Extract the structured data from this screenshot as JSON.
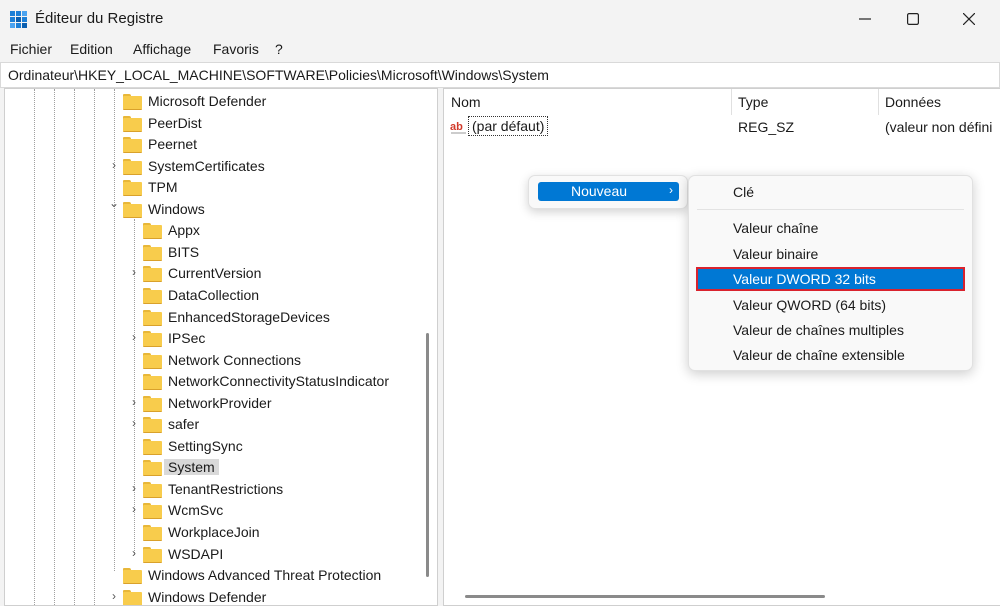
{
  "window": {
    "title": "Éditeur du Registre",
    "icon": "registry-icon",
    "controls": {
      "minimize": "minimize-icon",
      "maximize": "maximize-icon",
      "close": "close-icon"
    }
  },
  "menubar": {
    "items": [
      "Fichier",
      "Edition",
      "Affichage",
      "Favoris",
      "?"
    ]
  },
  "address": {
    "path": "Ordinateur\\HKEY_LOCAL_MACHINE\\SOFTWARE\\Policies\\Microsoft\\Windows\\System"
  },
  "tree": {
    "items": [
      {
        "label": "Microsoft Defender",
        "level": 0,
        "expander": ""
      },
      {
        "label": "PeerDist",
        "level": 0,
        "expander": ""
      },
      {
        "label": "Peernet",
        "level": 0,
        "expander": ""
      },
      {
        "label": "SystemCertificates",
        "level": 0,
        "expander": "collapsed"
      },
      {
        "label": "TPM",
        "level": 0,
        "expander": ""
      },
      {
        "label": "Windows",
        "level": 0,
        "expander": "expanded"
      },
      {
        "label": "Appx",
        "level": 1,
        "expander": ""
      },
      {
        "label": "BITS",
        "level": 1,
        "expander": ""
      },
      {
        "label": "CurrentVersion",
        "level": 1,
        "expander": "collapsed"
      },
      {
        "label": "DataCollection",
        "level": 1,
        "expander": ""
      },
      {
        "label": "EnhancedStorageDevices",
        "level": 1,
        "expander": ""
      },
      {
        "label": "IPSec",
        "level": 1,
        "expander": "collapsed"
      },
      {
        "label": "Network Connections",
        "level": 1,
        "expander": ""
      },
      {
        "label": "NetworkConnectivityStatusIndicator",
        "level": 1,
        "expander": ""
      },
      {
        "label": "NetworkProvider",
        "level": 1,
        "expander": "collapsed"
      },
      {
        "label": "safer",
        "level": 1,
        "expander": "collapsed"
      },
      {
        "label": "SettingSync",
        "level": 1,
        "expander": ""
      },
      {
        "label": "System",
        "level": 1,
        "expander": "",
        "selected": true
      },
      {
        "label": "TenantRestrictions",
        "level": 1,
        "expander": "collapsed"
      },
      {
        "label": "WcmSvc",
        "level": 1,
        "expander": "collapsed"
      },
      {
        "label": "WorkplaceJoin",
        "level": 1,
        "expander": ""
      },
      {
        "label": "WSDAPI",
        "level": 1,
        "expander": "collapsed"
      },
      {
        "label": "Windows Advanced Threat Protection",
        "level": 0,
        "expander": ""
      },
      {
        "label": "Windows Defender",
        "level": 0,
        "expander": "collapsed"
      }
    ]
  },
  "list": {
    "columns": [
      "Nom",
      "Type",
      "Données"
    ],
    "rows": [
      {
        "name": "(par défaut)",
        "type": "REG_SZ",
        "data": "(valeur non défini",
        "icon": "string-value-icon"
      }
    ]
  },
  "context_menu": {
    "nouveau_label": "Nouveau",
    "submenu": {
      "key": "Clé",
      "items": [
        "Valeur chaîne",
        "Valeur binaire",
        "Valeur DWORD 32 bits",
        "Valeur QWORD (64 bits)",
        "Valeur de chaînes multiples",
        "Valeur de chaîne extensible"
      ],
      "highlighted_index": 2
    }
  },
  "colors": {
    "accent": "#0078d4",
    "highlight_outline": "#d9232e",
    "folder": "#f8cc4c"
  }
}
